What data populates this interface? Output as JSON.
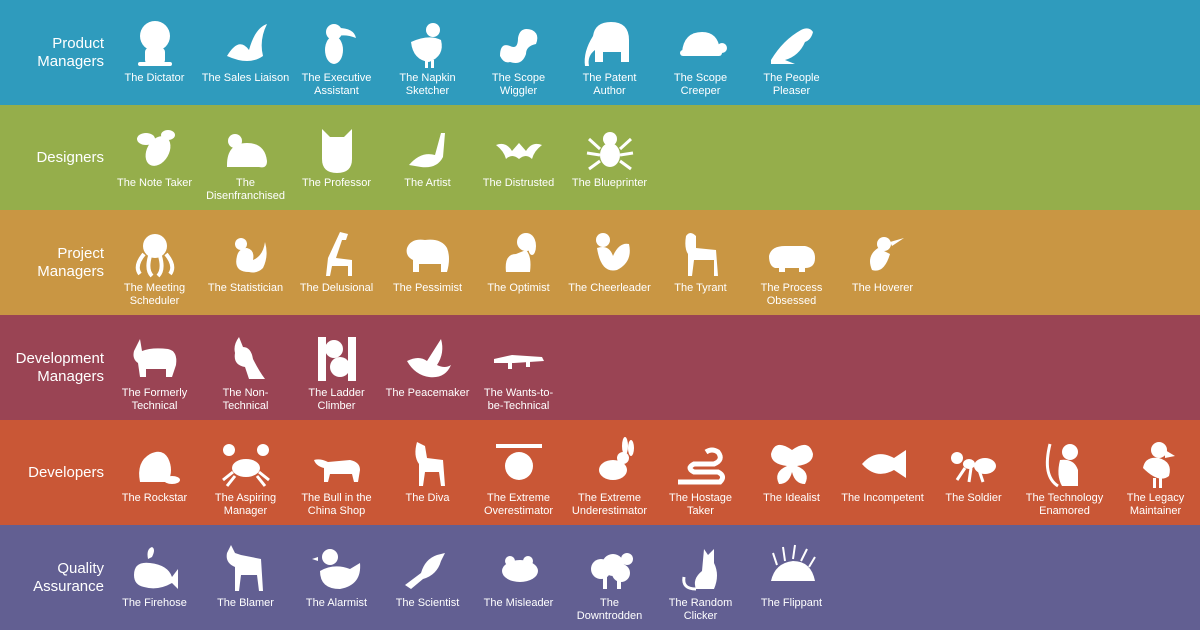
{
  "rows": [
    {
      "label": "Product\nManagers",
      "color": "#2f9bbd",
      "animals": [
        {
          "name": "The Dictator",
          "icon": "lion-icon"
        },
        {
          "name": "The Sales Liaison",
          "icon": "swan-icon"
        },
        {
          "name": "The Executive\nAssistant",
          "icon": "toucan-icon"
        },
        {
          "name": "The Napkin\nSketcher",
          "icon": "chicken-icon"
        },
        {
          "name": "The Scope\nWiggler",
          "icon": "worm-icon"
        },
        {
          "name": "The Patent\nAuthor",
          "icon": "elephant-icon"
        },
        {
          "name": "The Scope\nCreeper",
          "icon": "turtle-icon"
        },
        {
          "name": "The People\nPleaser",
          "icon": "seal-icon"
        }
      ]
    },
    {
      "label": "Designers",
      "color": "#95ae4b",
      "animals": [
        {
          "name": "The Note Taker",
          "icon": "bee-icon"
        },
        {
          "name": "The\nDisenfranchised",
          "icon": "mouse-icon"
        },
        {
          "name": "The Professor",
          "icon": "owl-icon"
        },
        {
          "name": "The Artist",
          "icon": "peacock-icon"
        },
        {
          "name": "The Distrusted",
          "icon": "bat-icon"
        },
        {
          "name": "The Blueprinter",
          "icon": "spider-icon"
        }
      ]
    },
    {
      "label": "Project\nManagers",
      "color": "#c99643",
      "animals": [
        {
          "name": "The Meeting\nScheduler",
          "icon": "octopus-icon"
        },
        {
          "name": "The Statistician",
          "icon": "squirrel-icon"
        },
        {
          "name": "The Delusional",
          "icon": "giraffe-icon"
        },
        {
          "name": "The Pessimist",
          "icon": "bear-icon"
        },
        {
          "name": "The Optimist",
          "icon": "dog-icon"
        },
        {
          "name": "The Cheerleader",
          "icon": "rooster-icon"
        },
        {
          "name": "The Tyrant",
          "icon": "goat-icon"
        },
        {
          "name": "The Process\nObsessed",
          "icon": "hippo-icon"
        },
        {
          "name": "The Hoverer",
          "icon": "hummingbird-icon"
        }
      ]
    },
    {
      "label": "Development\nManagers",
      "color": "#9a4454",
      "animals": [
        {
          "name": "The Formerly\nTechnical",
          "icon": "rhino-icon"
        },
        {
          "name": "The Non-\nTechnical",
          "icon": "kangaroo-icon"
        },
        {
          "name": "The Ladder\nClimber",
          "icon": "koala-icon"
        },
        {
          "name": "The Peacemaker",
          "icon": "dove-icon"
        },
        {
          "name": "The Wants-to-\nbe-Technical",
          "icon": "crocodile-icon"
        }
      ]
    },
    {
      "label": "Developers",
      "color": "#c95736",
      "animals": [
        {
          "name": "The Rockstar",
          "icon": "beaver-icon"
        },
        {
          "name": "The Aspiring\nManager",
          "icon": "crab-icon"
        },
        {
          "name": "The Bull in the\nChina Shop",
          "icon": "bull-icon"
        },
        {
          "name": "The Diva",
          "icon": "zebra-icon"
        },
        {
          "name": "The Extreme\nOverestimator",
          "icon": "sloth-icon"
        },
        {
          "name": "The Extreme\nUnderestimator",
          "icon": "rabbit-icon"
        },
        {
          "name": "The Hostage\nTaker",
          "icon": "snake-icon"
        },
        {
          "name": "The Idealist",
          "icon": "butterfly-icon"
        },
        {
          "name": "The Incompetent",
          "icon": "clownfish-icon"
        },
        {
          "name": "The Soldier",
          "icon": "ant-icon"
        },
        {
          "name": "The Technology\nEnamored",
          "icon": "monkey-icon"
        },
        {
          "name": "The Legacy\nMaintainer",
          "icon": "dodo-icon"
        }
      ]
    },
    {
      "label": "Quality\nAssurance",
      "color": "#625f92",
      "animals": [
        {
          "name": "The Firehose",
          "icon": "whale-icon"
        },
        {
          "name": "The Blamer",
          "icon": "donkey-icon"
        },
        {
          "name": "The Alarmist",
          "icon": "duck-icon"
        },
        {
          "name": "The Scientist",
          "icon": "crow-icon"
        },
        {
          "name": "The Misleader",
          "icon": "frog-icon"
        },
        {
          "name": "The\nDowntrodden",
          "icon": "sheep-icon"
        },
        {
          "name": "The Random\nClicker",
          "icon": "cat-icon"
        },
        {
          "name": "The Flippant",
          "icon": "porcupine-icon"
        }
      ]
    }
  ]
}
